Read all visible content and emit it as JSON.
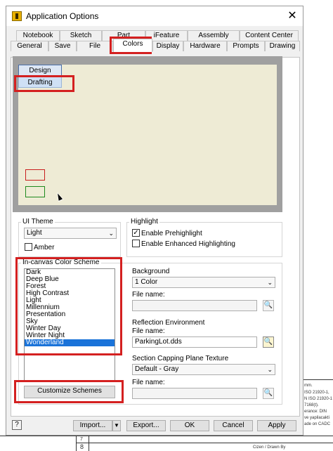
{
  "window": {
    "title": "Application Options",
    "close_glyph": "✕"
  },
  "tabs": {
    "row1": [
      "Notebook",
      "Sketch",
      "Part",
      "iFeature",
      "Assembly",
      "Content Center"
    ],
    "row2": [
      "General",
      "Save",
      "File",
      "Colors",
      "Display",
      "Hardware",
      "Prompts",
      "Drawing"
    ],
    "active": "Colors"
  },
  "preview": {
    "design_label": "Design",
    "drafting_label": "Drafting"
  },
  "ui_theme": {
    "group_label": "UI Theme",
    "selected": "Light",
    "amber_label": "Amber",
    "amber_checked": false
  },
  "highlight": {
    "group_label": "Highlight",
    "prehighlight_label": "Enable Prehighlight",
    "prehighlight_checked": true,
    "enhanced_label": "Enable Enhanced Highlighting",
    "enhanced_checked": false
  },
  "color_scheme": {
    "group_label": "In-canvas Color Scheme",
    "items": [
      "Dark",
      "Deep Blue",
      "Forest",
      "High Contrast",
      "Light",
      "Millennium",
      "Presentation",
      "Sky",
      "Winter Day",
      "Winter Night",
      "Wonderland"
    ],
    "selected": "Wonderland",
    "customize_label": "Customize Schemes"
  },
  "background": {
    "label": "Background",
    "selected": "1 Color",
    "file_label": "File name:",
    "file_value": ""
  },
  "reflection": {
    "label": "Reflection Environment",
    "file_label": "File name:",
    "file_value": "ParkingLot.dds"
  },
  "capping": {
    "label": "Section Capping Plane Texture",
    "selected": "Default - Gray",
    "file_label": "File name:",
    "file_value": ""
  },
  "footer": {
    "help_glyph": "?",
    "import_label": "Import...",
    "export_label": "Export...",
    "ok_label": "OK",
    "cancel_label": "Cancel",
    "apply_label": "Apply"
  },
  "cad_background": {
    "notes": [
      "mm.",
      "ISO 21920-1,",
      "N ISO 21920-1",
      "7168(t).",
      "erance: DIN",
      "ve yapilacakti",
      "ade on CADC"
    ],
    "row_numbers": [
      "7",
      "8"
    ],
    "drawn_by": "Cizen / Drawn By"
  },
  "colors": {
    "highlight_red": "#d42020",
    "list_selected": "#1a73d9",
    "preview_canvas": "#eeebd5"
  }
}
